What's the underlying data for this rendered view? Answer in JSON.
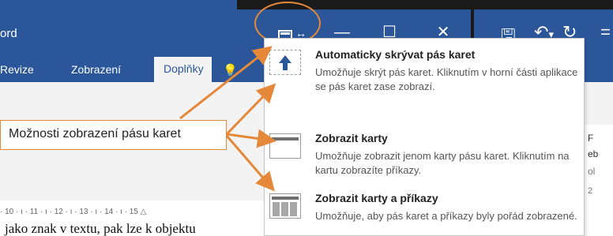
{
  "window": {
    "app_name": "ord",
    "ribbon_options_icon": "ribbon-display-options-icon",
    "minimize": "—",
    "maximize": "☐",
    "close": "✕"
  },
  "qat": {
    "save": "🖫",
    "undo": "↶",
    "dropdown": "▾",
    "redo": "↻",
    "more": "="
  },
  "tabs": [
    "Revize",
    "Zobrazení",
    "Doplňky"
  ],
  "tell_me_icon": "lightbulb-icon",
  "callout": {
    "text": "Možnosti zobrazení pásu karet"
  },
  "ruler": "· 10 · ı · 11 · ı · 12 · ı · 13 · ı · 14 · ı · 15 △",
  "document": {
    "text": "jako znak v textu, pak lze k objektu"
  },
  "right_pane": [
    "F",
    "eb",
    "ol",
    "2"
  ],
  "menu": {
    "options": [
      {
        "title": "Automaticky skrývat pás karet",
        "desc": "Umožňuje skrýt pás karet. Kliknutím v horní části aplikace se pás karet zase zobrazí.",
        "icon": "auto-hide-ribbon-icon"
      },
      {
        "title": "Zobrazit karty",
        "desc": "Umožňuje zobrazit jenom karty pásu karet. Kliknutím na kartu zobrazíte příkazy.",
        "icon": "show-tabs-icon"
      },
      {
        "title": "Zobrazit karty a příkazy",
        "desc": "Umožňuje, aby pás karet a příkazy byly pořád zobrazené.",
        "icon": "show-tabs-commands-icon"
      }
    ]
  },
  "colors": {
    "word_blue": "#2b579a",
    "annotation_orange": "#e6883a"
  }
}
